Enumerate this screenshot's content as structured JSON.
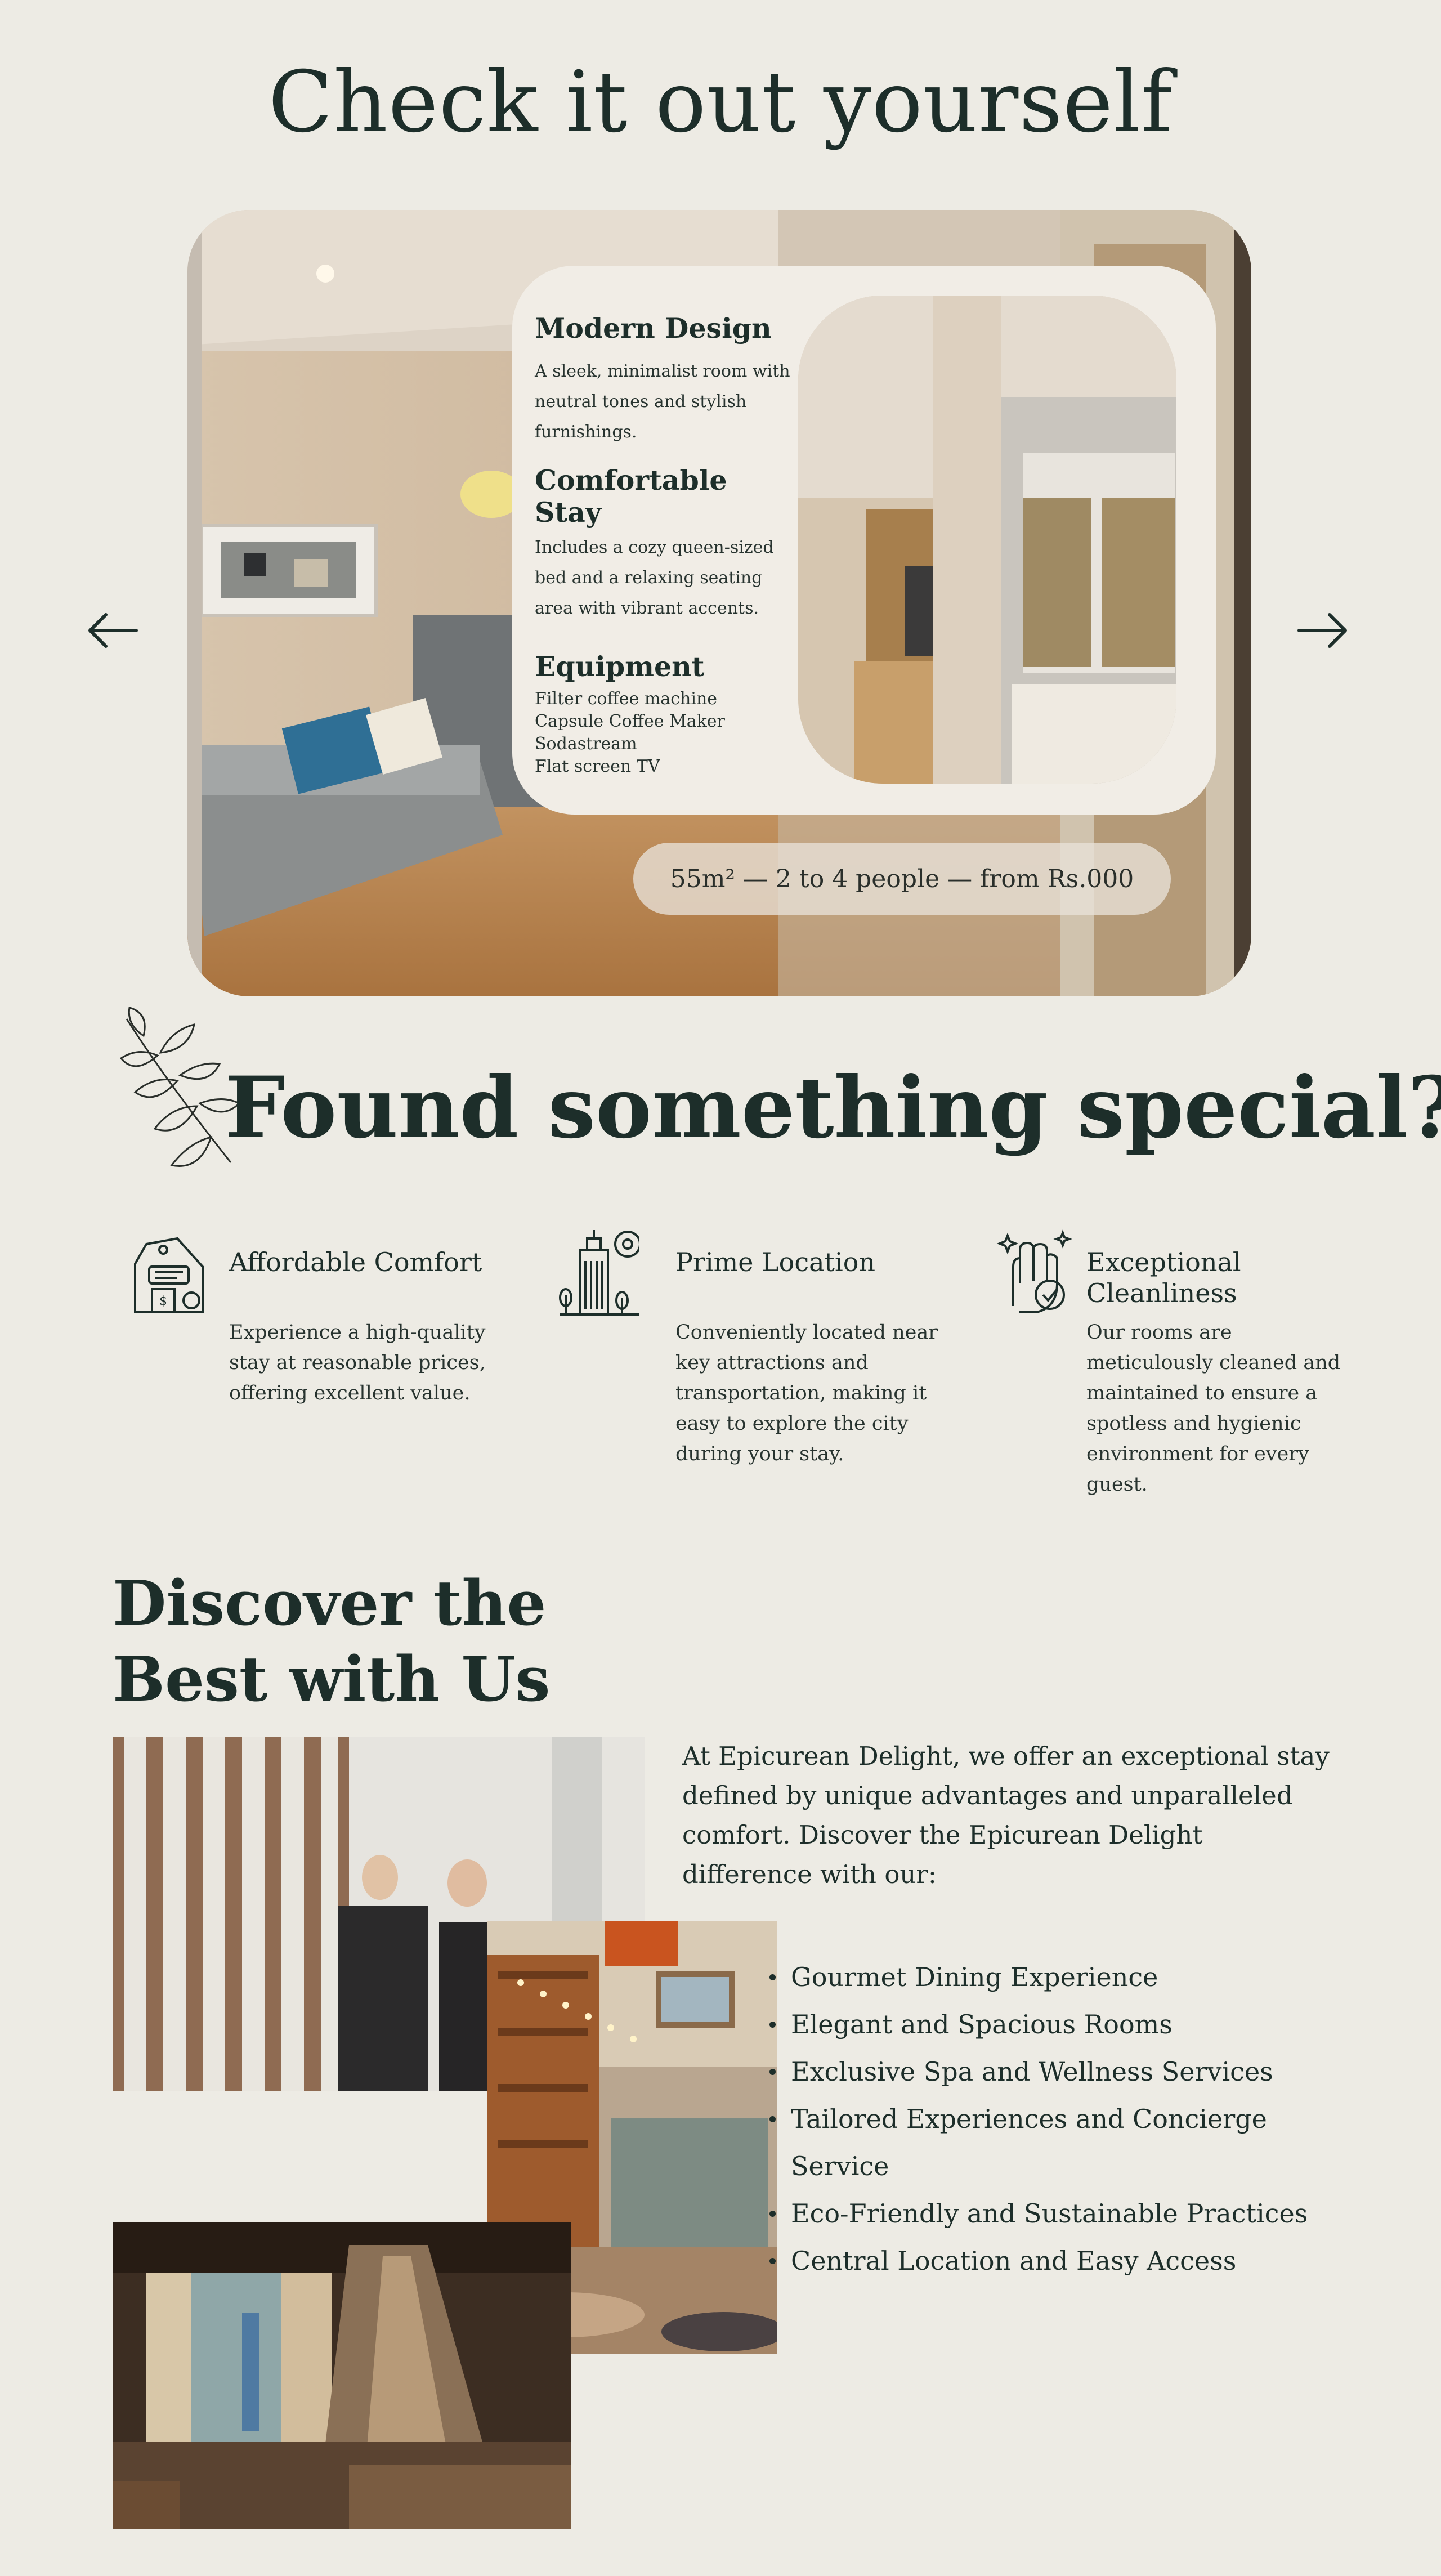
{
  "section1": {
    "title": "Check it out yourself",
    "card": {
      "modern_title": "Modern Design",
      "modern_desc": "A sleek, minimalist room with neutral tones and stylish furnishings.",
      "comfort_title": "Comfortable Stay",
      "comfort_desc": "Includes a cozy queen-sized bed and a relaxing seating area with vibrant accents.",
      "equipment_title": "Equipment",
      "equipment_items": [
        "Filter coffee machine",
        "Capsule Coffee Maker",
        "Sodastream",
        "Flat screen TV"
      ]
    },
    "summary": "55m² — 2 to 4 people — from Rs.000",
    "prev_icon": "arrow-left-icon",
    "next_icon": "arrow-right-icon"
  },
  "section2": {
    "title": "Found something special?",
    "features": [
      {
        "icon": "price-tag-icon",
        "title": "Affordable Comfort",
        "desc": "Experience a high-quality stay at reasonable prices, offering excellent value."
      },
      {
        "icon": "city-building-icon",
        "title": "Prime Location",
        "desc": "Conveniently located near key attractions and transportation, making it easy to explore the city during your stay."
      },
      {
        "icon": "clean-hand-icon",
        "title": "Exceptional Cleanliness",
        "desc": "Our rooms are meticulously cleaned and maintained to ensure a spotless and hygienic environment for every guest."
      }
    ]
  },
  "section3": {
    "title": "Discover the Best with Us",
    "intro": "At Epicurean Delight, we offer an exceptional stay defined by unique advantages and unparalleled comfort. Discover the Epicurean Delight difference with our:",
    "benefits": [
      "Gourmet Dining Experience",
      "Elegant and Spacious Rooms",
      "Exclusive Spa and Wellness Services",
      "Tailored Experiences and Concierge Service",
      "Eco-Friendly and Sustainable Practices",
      "Central Location and Easy Access"
    ]
  },
  "colors": {
    "background": "#edebe4",
    "heading": "#1d2e2a",
    "card": "#f1ede6"
  }
}
